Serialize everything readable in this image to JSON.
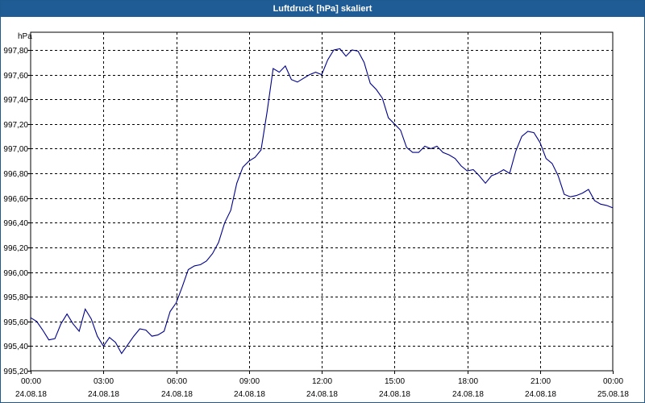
{
  "window": {
    "title": "Luftdruck [hPa] skaliert"
  },
  "colors": {
    "titlebar": "#1f5c95",
    "line": "#00008b",
    "grid": "#000000"
  },
  "chart_data": {
    "type": "line",
    "title": "Luftdruck [hPa] skaliert",
    "ylabel": "hPa",
    "ylim": [
      995.2,
      997.9
    ],
    "yticks": [
      "995,20",
      "995,40",
      "995,60",
      "995,80",
      "996,00",
      "996,20",
      "996,40",
      "996,60",
      "996,80",
      "997,00",
      "997,20",
      "997,40",
      "997,60",
      "997,80"
    ],
    "xlim": [
      "2018-08-24 00:00",
      "2018-08-25 00:00"
    ],
    "xticks": [
      {
        "time": "00:00",
        "date": "24.08.18"
      },
      {
        "time": "03:00",
        "date": "24.08.18"
      },
      {
        "time": "06:00",
        "date": "24.08.18"
      },
      {
        "time": "09:00",
        "date": "24.08.18"
      },
      {
        "time": "12:00",
        "date": "24.08.18"
      },
      {
        "time": "15:00",
        "date": "24.08.18"
      },
      {
        "time": "18:00",
        "date": "24.08.18"
      },
      {
        "time": "21:00",
        "date": "24.08.18"
      },
      {
        "time": "00:00",
        "date": "25.08.18"
      }
    ],
    "grid": true,
    "series": [
      {
        "x": [
          "00:00",
          "00:15",
          "00:30",
          "00:45",
          "01:00",
          "01:15",
          "01:30",
          "01:45",
          "02:00",
          "02:15",
          "02:30",
          "02:45",
          "03:00",
          "03:15",
          "03:30",
          "03:45",
          "04:00",
          "04:15",
          "04:30",
          "04:45",
          "05:00",
          "05:15",
          "05:30",
          "05:45",
          "06:00",
          "06:15",
          "06:30",
          "06:45",
          "07:00",
          "07:15",
          "07:30",
          "07:45",
          "08:00",
          "08:15",
          "08:30",
          "08:45",
          "09:00",
          "09:15",
          "09:30",
          "09:45",
          "10:00",
          "10:15",
          "10:30",
          "10:45",
          "11:00",
          "11:15",
          "11:30",
          "11:45",
          "12:00",
          "12:15",
          "12:30",
          "12:45",
          "13:00",
          "13:15",
          "13:30",
          "13:45",
          "14:00",
          "14:15",
          "14:30",
          "14:45",
          "15:00",
          "15:15",
          "15:30",
          "15:45",
          "16:00",
          "16:15",
          "16:30",
          "16:45",
          "17:00",
          "17:15",
          "17:30",
          "17:45",
          "18:00",
          "18:15",
          "18:30",
          "18:45",
          "19:00",
          "19:15",
          "19:30",
          "19:45",
          "20:00",
          "20:15",
          "20:30",
          "20:45",
          "21:00",
          "21:15",
          "21:30",
          "21:45",
          "22:00",
          "22:15",
          "22:30",
          "22:45",
          "23:00",
          "23:15",
          "23:30",
          "23:45",
          "24:00"
        ],
        "values": [
          995.63,
          995.6,
          995.53,
          995.45,
          995.46,
          995.58,
          995.66,
          995.58,
          995.52,
          995.7,
          995.62,
          995.48,
          995.4,
          995.47,
          995.43,
          995.34,
          995.41,
          995.48,
          995.54,
          995.53,
          995.48,
          995.49,
          995.52,
          995.68,
          995.75,
          995.88,
          996.02,
          996.05,
          996.06,
          996.09,
          996.15,
          996.24,
          996.4,
          996.5,
          996.72,
          996.85,
          996.9,
          996.93,
          996.99,
          997.3,
          997.65,
          997.62,
          997.67,
          997.56,
          997.54,
          997.57,
          997.6,
          997.62,
          997.6,
          997.72,
          997.8,
          997.81,
          997.75,
          997.8,
          997.79,
          997.7,
          997.53,
          997.48,
          997.41,
          997.25,
          997.2,
          997.15,
          997.01,
          996.97,
          996.97,
          997.02,
          997.0,
          997.02,
          996.97,
          996.95,
          996.92,
          996.86,
          996.82,
          996.83,
          996.78,
          996.72,
          996.78,
          996.8,
          996.83,
          996.8,
          996.98,
          997.1,
          997.14,
          997.13,
          997.05,
          996.92,
          996.88,
          996.78,
          996.63,
          996.61,
          996.62,
          996.64,
          996.67,
          996.58,
          996.55,
          996.54,
          996.52
        ]
      }
    ]
  }
}
